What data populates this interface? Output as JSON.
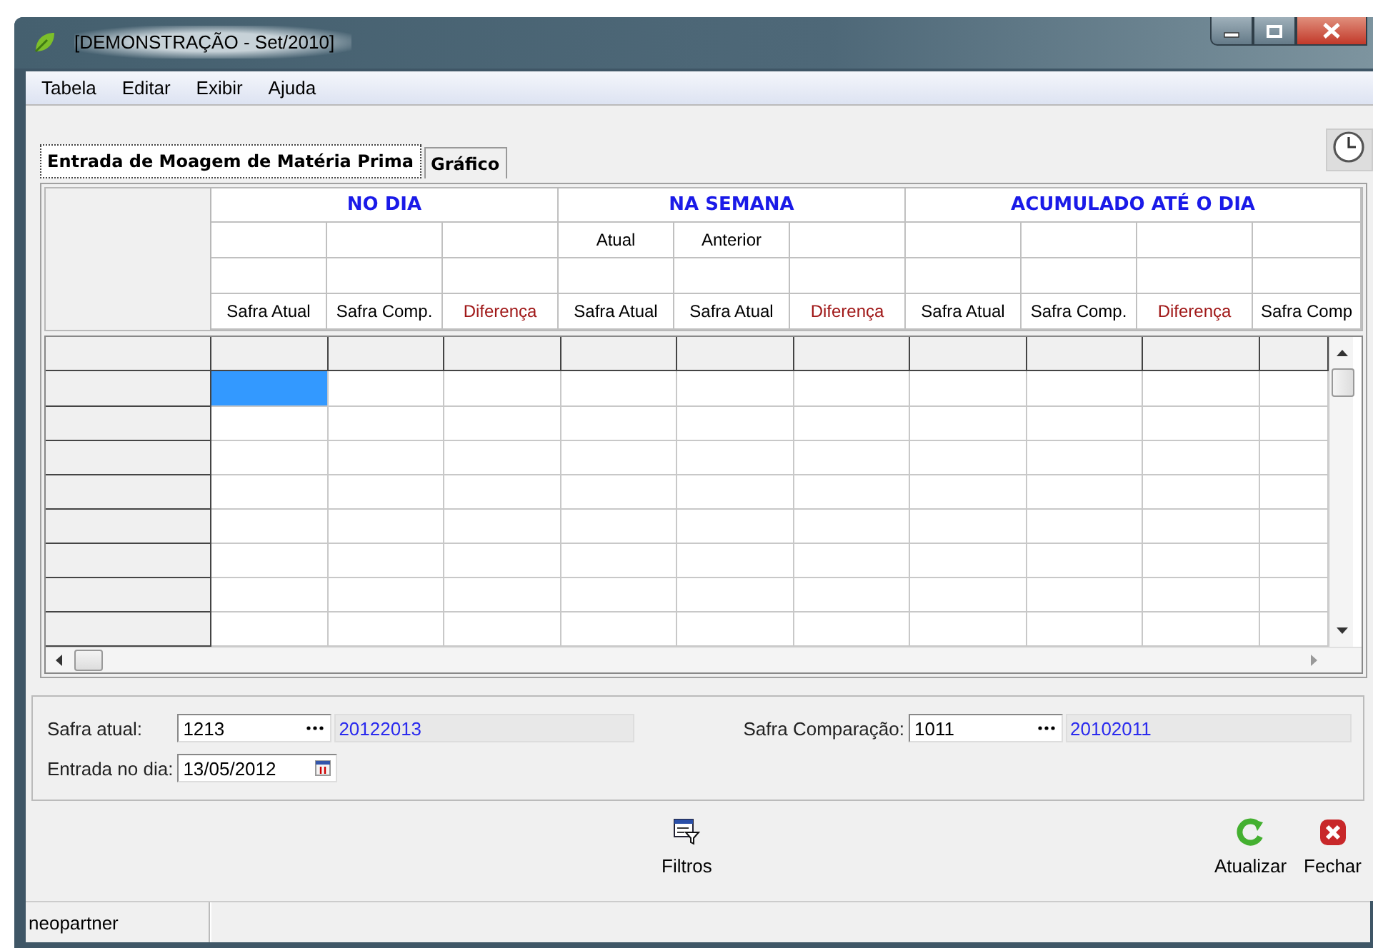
{
  "window": {
    "title": "[DEMONSTRAÇÃO - Set/2010]"
  },
  "menu": [
    "Tabela",
    "Editar",
    "Exibir",
    "Ajuda"
  ],
  "tabs": [
    {
      "label": "Entrada de Moagem de Matéria Prima",
      "selected": true
    },
    {
      "label": "Gráfico",
      "selected": false
    }
  ],
  "header": {
    "groups": [
      {
        "title": "NO DIA",
        "columns": [
          {
            "label": "Safra Atual",
            "kind": "value"
          },
          {
            "label": "Safra Comp.",
            "kind": "value"
          },
          {
            "label": "Diferença",
            "kind": "difference"
          }
        ]
      },
      {
        "title": "NA SEMANA",
        "columns": [
          {
            "sub_label": "Atual",
            "label": "Safra Atual",
            "kind": "value"
          },
          {
            "sub_label": "Anterior",
            "label": "Safra Atual",
            "kind": "value"
          },
          {
            "label": "Diferença",
            "kind": "difference"
          }
        ]
      },
      {
        "title": "ACUMULADO ATÉ O DIA",
        "columns": [
          {
            "label": "Safra Atual",
            "kind": "value"
          },
          {
            "label": "Safra Comp.",
            "kind": "value"
          },
          {
            "label": "Diferença",
            "kind": "difference"
          },
          {
            "label": "Safra Comp",
            "kind": "value"
          }
        ]
      }
    ]
  },
  "grid": {
    "rows": [
      {
        "cells": [
          {
            "selected": true
          },
          {
            "selected": false
          },
          {
            "selected": false
          },
          {
            "selected": false
          },
          {
            "selected": false
          },
          {
            "selected": false
          },
          {
            "selected": false
          },
          {
            "selected": false
          },
          {
            "selected": false
          },
          {
            "selected": false
          }
        ]
      },
      {
        "cells": [
          {
            "selected": false
          },
          {
            "selected": false
          },
          {
            "selected": false
          },
          {
            "selected": false
          },
          {
            "selected": false
          },
          {
            "selected": false
          },
          {
            "selected": false
          },
          {
            "selected": false
          },
          {
            "selected": false
          },
          {
            "selected": false
          }
        ]
      },
      {
        "cells": [
          {
            "selected": false
          },
          {
            "selected": false
          },
          {
            "selected": false
          },
          {
            "selected": false
          },
          {
            "selected": false
          },
          {
            "selected": false
          },
          {
            "selected": false
          },
          {
            "selected": false
          },
          {
            "selected": false
          },
          {
            "selected": false
          }
        ]
      },
      {
        "cells": [
          {
            "selected": false
          },
          {
            "selected": false
          },
          {
            "selected": false
          },
          {
            "selected": false
          },
          {
            "selected": false
          },
          {
            "selected": false
          },
          {
            "selected": false
          },
          {
            "selected": false
          },
          {
            "selected": false
          },
          {
            "selected": false
          }
        ]
      },
      {
        "cells": [
          {
            "selected": false
          },
          {
            "selected": false
          },
          {
            "selected": false
          },
          {
            "selected": false
          },
          {
            "selected": false
          },
          {
            "selected": false
          },
          {
            "selected": false
          },
          {
            "selected": false
          },
          {
            "selected": false
          },
          {
            "selected": false
          }
        ]
      },
      {
        "cells": [
          {
            "selected": false
          },
          {
            "selected": false
          },
          {
            "selected": false
          },
          {
            "selected": false
          },
          {
            "selected": false
          },
          {
            "selected": false
          },
          {
            "selected": false
          },
          {
            "selected": false
          },
          {
            "selected": false
          },
          {
            "selected": false
          }
        ]
      },
      {
        "cells": [
          {
            "selected": false
          },
          {
            "selected": false
          },
          {
            "selected": false
          },
          {
            "selected": false
          },
          {
            "selected": false
          },
          {
            "selected": false
          },
          {
            "selected": false
          },
          {
            "selected": false
          },
          {
            "selected": false
          },
          {
            "selected": false
          }
        ]
      },
      {
        "cells": [
          {
            "selected": false
          },
          {
            "selected": false
          },
          {
            "selected": false
          },
          {
            "selected": false
          },
          {
            "selected": false
          },
          {
            "selected": false
          },
          {
            "selected": false
          },
          {
            "selected": false
          },
          {
            "selected": false
          },
          {
            "selected": false
          }
        ]
      }
    ]
  },
  "filters": {
    "safra_atual": {
      "label": "Safra atual:",
      "value": "1213",
      "description": "20122013"
    },
    "safra_comparacao": {
      "label": "Safra Comparação:",
      "value": "1011",
      "description": "20102011"
    },
    "entrada_no_dia": {
      "label": "Entrada no dia:",
      "value": "13/05/2012"
    }
  },
  "actions": [
    {
      "label": "Filtros",
      "kind": "filter"
    },
    {
      "label": "Atualizar",
      "kind": "refresh"
    },
    {
      "label": "Fechar",
      "kind": "close"
    }
  ],
  "status_bar": {
    "user": "neopartner"
  }
}
